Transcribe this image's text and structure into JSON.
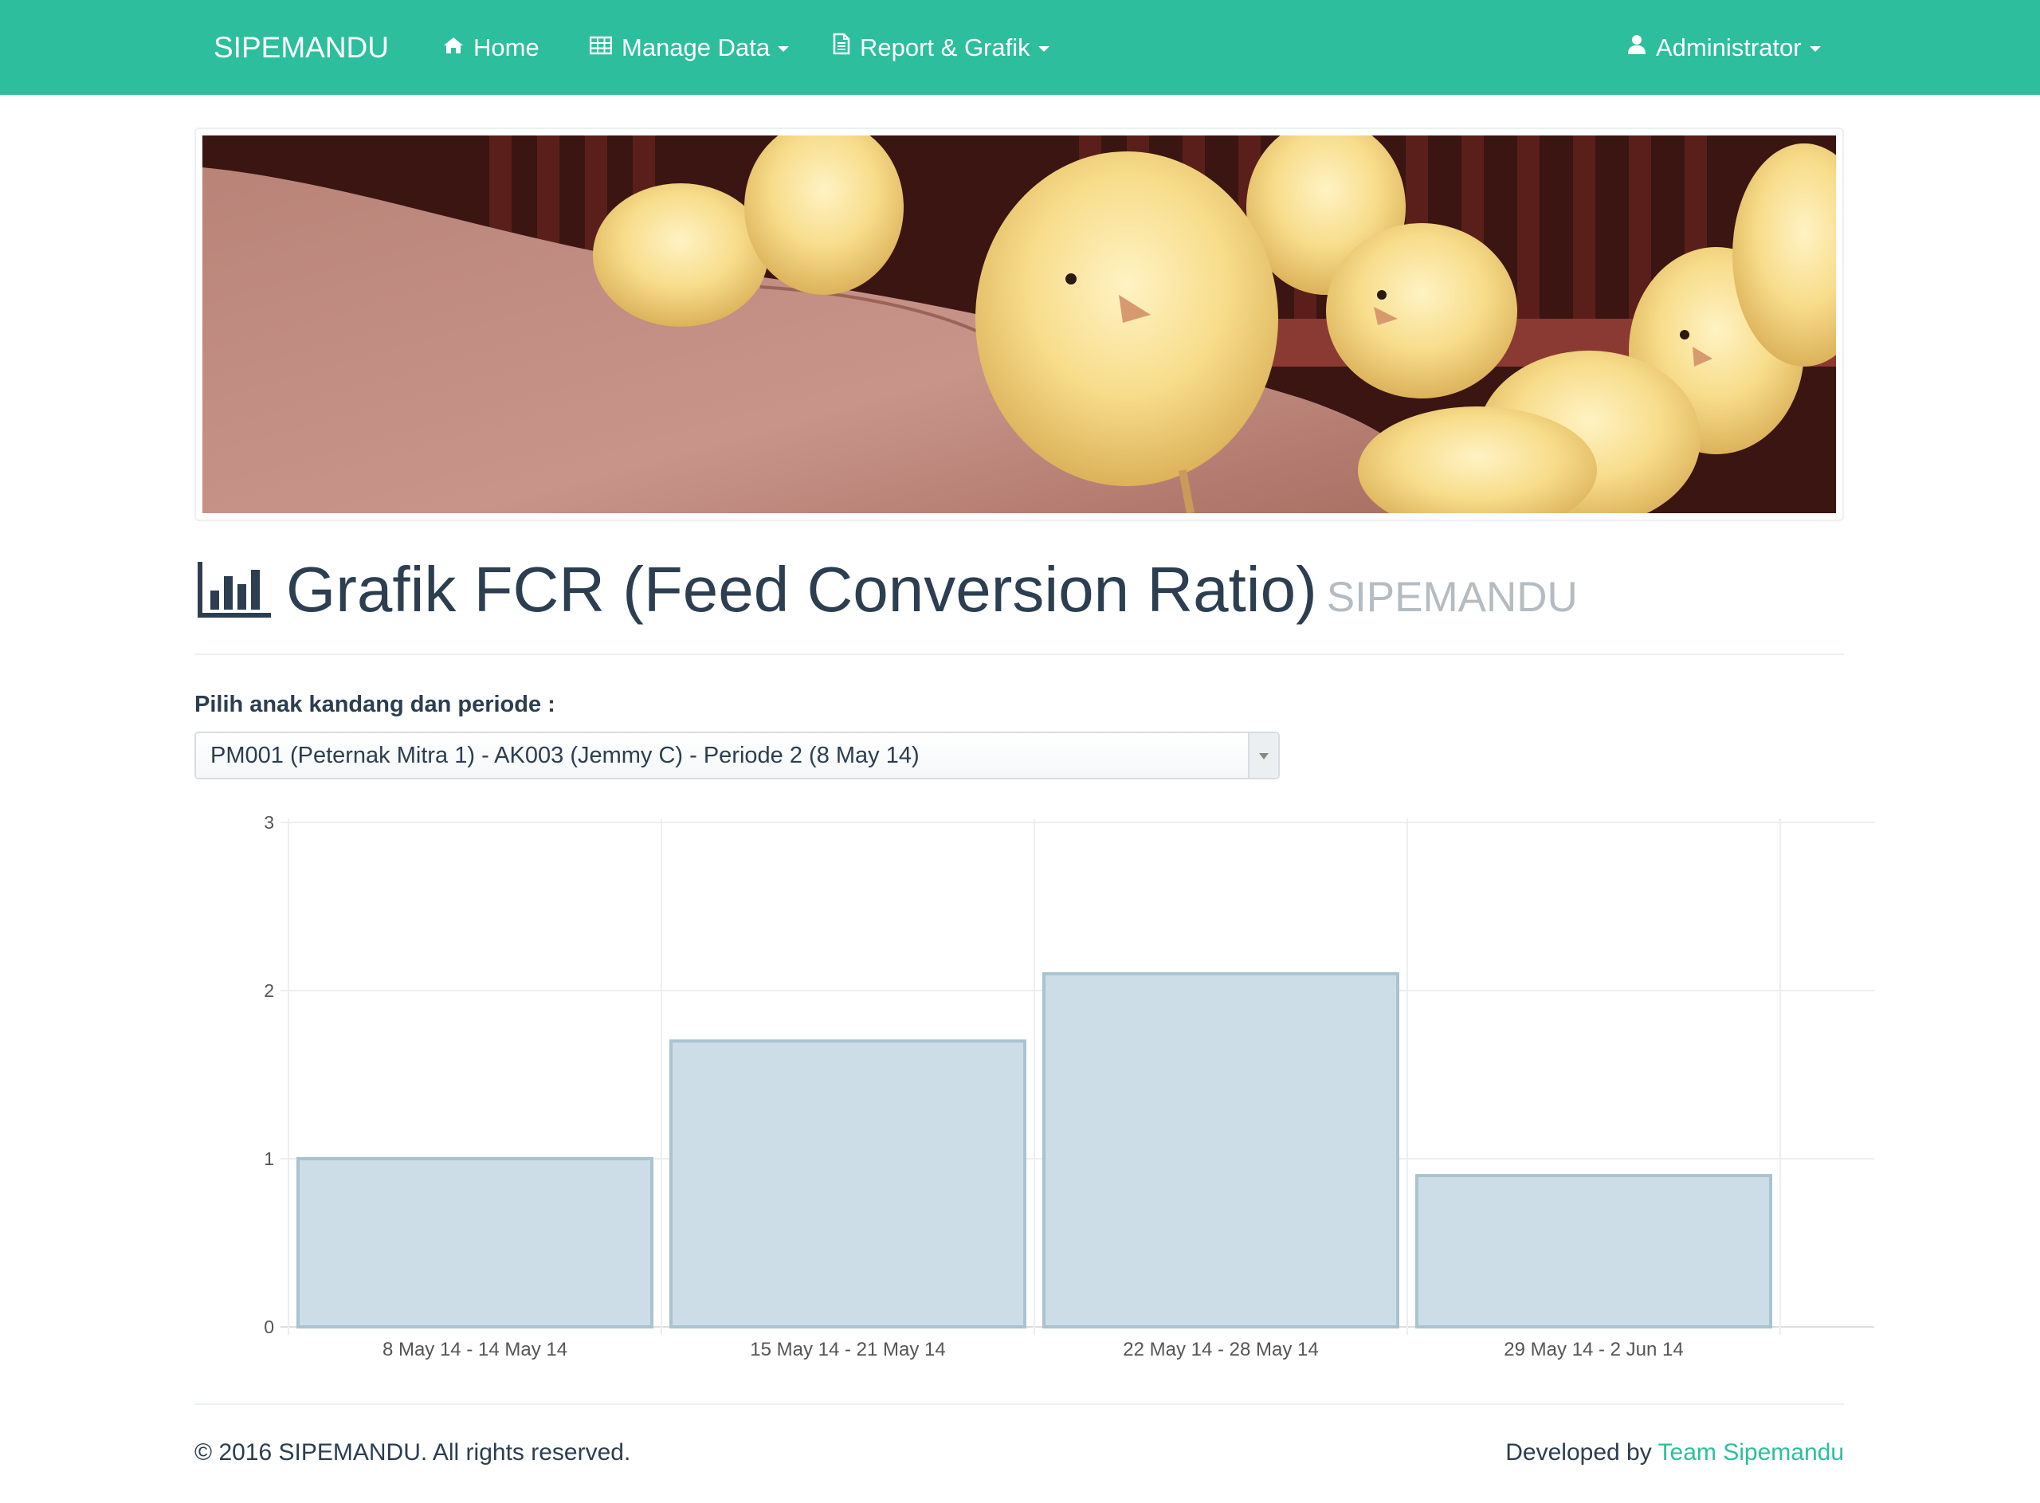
{
  "navbar": {
    "brand": "SIPEMANDU",
    "items": [
      {
        "label": "Home",
        "icon": "home-icon"
      },
      {
        "label": "Manage Data",
        "icon": "table-icon"
      },
      {
        "label": "Report & Grafik",
        "icon": "document-icon"
      }
    ],
    "user": {
      "label": "Administrator",
      "icon": "user-icon"
    },
    "color": "#2dbe9e"
  },
  "header": {
    "icon": "bar-chart-icon",
    "title": "Grafik FCR (Feed Conversion Ratio)",
    "subtitle": "SIPEMANDU"
  },
  "form": {
    "label": "Pilih anak kandang dan periode :",
    "selected": "PM001 (Peternak Mitra 1) - AK003 (Jemmy C) - Periode 2 (8 May 14)"
  },
  "chart_data": {
    "type": "bar",
    "categories": [
      "8 May 14 - 14 May 14",
      "15 May 14 - 21 May 14",
      "22 May 14 - 28 May 14",
      "29 May 14 - 2 Jun 14"
    ],
    "values": [
      1.0,
      1.7,
      2.1,
      0.9
    ],
    "ylim": [
      0,
      3
    ],
    "yticks": [
      0,
      1,
      2,
      3
    ],
    "grid": true,
    "bar_fill": "#cddde7",
    "bar_stroke": "#a9c3cf"
  },
  "footer": {
    "copyright": "© 2016 SIPEMANDU. All rights reserved.",
    "developed_by": "Developed by",
    "team": "Team Sipemandu"
  }
}
